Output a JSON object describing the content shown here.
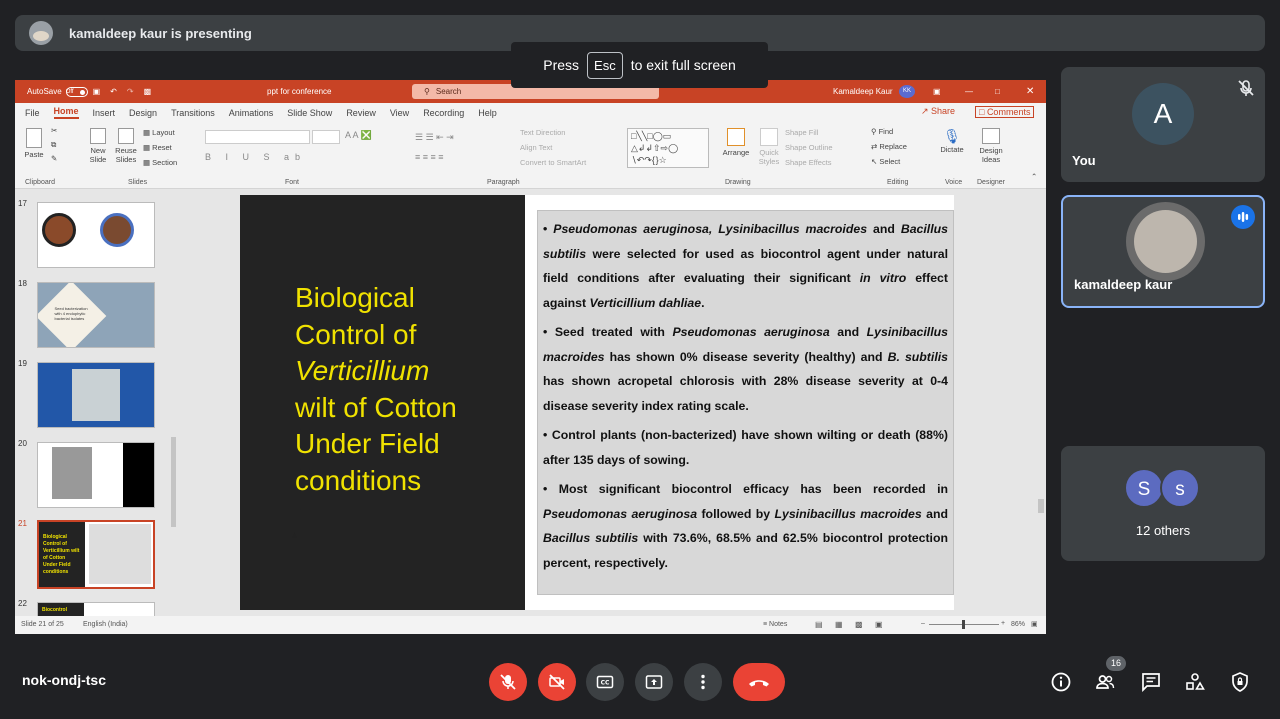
{
  "presenter_bar": {
    "text": "kamaldeep kaur is presenting"
  },
  "fullscreen_toast": {
    "prefix": "Press",
    "key": "Esc",
    "suffix": "to exit full screen"
  },
  "ppt": {
    "autosave": "AutoSave",
    "autosave_state": "Off",
    "file_name": "ppt for conference",
    "search_placeholder": "Search",
    "user": "Kamaldeep Kaur",
    "user_initials": "KK",
    "menu": [
      "File",
      "Home",
      "Insert",
      "Design",
      "Transitions",
      "Animations",
      "Slide Show",
      "Review",
      "View",
      "Recording",
      "Help"
    ],
    "active_menu": "Home",
    "share": "Share",
    "comments": "Comments",
    "ribbon": {
      "paste": "Paste",
      "new_slide": "New Slide",
      "reuse_slides": "Reuse Slides",
      "layout": "Layout",
      "reset": "Reset",
      "section": "Section",
      "text_direction": "Text Direction",
      "align_text": "Align Text",
      "convert_smartart": "Convert to SmartArt",
      "arrange": "Arrange",
      "quick_styles": "Quick Styles",
      "shape_fill": "Shape Fill",
      "shape_outline": "Shape Outline",
      "shape_effects": "Shape Effects",
      "find": "Find",
      "replace": "Replace",
      "select": "Select",
      "dictate": "Dictate",
      "design_ideas": "Design Ideas",
      "groups": [
        "Clipboard",
        "Slides",
        "Font",
        "Paragraph",
        "Drawing",
        "Editing",
        "Voice",
        "Designer"
      ]
    },
    "thumbnails": [
      {
        "num": "17"
      },
      {
        "num": "18",
        "caption": "Seed bacterization with 4 endophytic bacterial isolates"
      },
      {
        "num": "19"
      },
      {
        "num": "20"
      },
      {
        "num": "21",
        "caption": "Biological Control of Verticillium wilt of Cotton Under Field conditions"
      },
      {
        "num": "22",
        "caption": "Biocontrol"
      }
    ],
    "slide": {
      "title_line1": "Biological",
      "title_line2": "Control of",
      "title_line3": "Verticillium",
      "title_line4": "wilt of Cotton",
      "title_line5": "Under Field",
      "title_line6": "conditions",
      "b1_a": "• ",
      "b1_b": "Pseudomonas aeruginosa, Lysinibacillus macroides",
      "b1_c": " and ",
      "b1_d": "Bacillus subtilis",
      "b1_e": " were selected for used as biocontrol agent under natural field conditions after evaluating their significant ",
      "b1_f": "in vitro",
      "b1_g": " effect against ",
      "b1_h": "Verticillium dahliae",
      "b1_i": ".",
      "b2_a": "• Seed treated with ",
      "b2_b": "Pseudomonas aeruginosa",
      "b2_c": " and ",
      "b2_d": "Lysinibacillus macroides",
      "b2_e": " has shown 0% disease severity (healthy) and ",
      "b2_f": "B. subtilis",
      "b2_g": " has shown acropetal chlorosis with 28% disease severity at 0-4 disease severity index rating scale.",
      "b3": "• Control plants (non-bacterized) have shown wilting or death (88%) after 135 days of sowing.",
      "b4_a": "• Most significant biocontrol efficacy has been recorded in ",
      "b4_b": "Pseudomonas aeruginosa",
      "b4_c": " followed by ",
      "b4_d": "Lysinibacillus macroides",
      "b4_e": " and ",
      "b4_f": "Bacillus subtilis",
      "b4_g": " with 73.6%, 68.5% and 62.5% biocontrol protection percent, respectively."
    },
    "status": {
      "slide_of": "Slide 21 of 25",
      "language": "English (India)",
      "notes": "Notes",
      "zoom": "86%"
    }
  },
  "tiles": {
    "you": {
      "initial": "A",
      "name": "You"
    },
    "presenter": {
      "name": "kamaldeep kaur"
    },
    "others": {
      "avatar1": "S",
      "avatar2": "s",
      "label": "12 others"
    }
  },
  "meeting": {
    "code": "nok-ondj-tsc",
    "participants_count": "16"
  },
  "colors": {
    "ppt_accent": "#c84325",
    "slide_title": "#f0e200",
    "hangup": "#ea4335",
    "speaking": "#1a73e8"
  }
}
